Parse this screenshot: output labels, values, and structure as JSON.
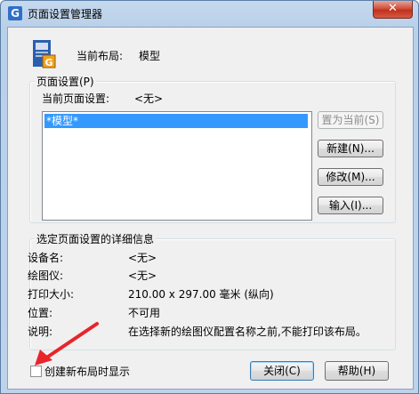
{
  "window": {
    "title": "页面设置管理器",
    "app_icon_letter": "G",
    "close_glyph": "✕"
  },
  "current_layout": {
    "label": "当前布局:",
    "value": "模型"
  },
  "page_setup": {
    "group_title": "页面设置(P)",
    "current_label": "当前页面设置:",
    "current_value": "<无>",
    "list_items": [
      "*模型*"
    ],
    "buttons": {
      "set_current": "置为当前(S)",
      "new": "新建(N)...",
      "modify": "修改(M)...",
      "import": "输入(I)..."
    }
  },
  "details": {
    "group_title": "选定页面设置的详细信息",
    "rows": [
      {
        "label": "设备名:",
        "value": "<无>"
      },
      {
        "label": "绘图仪:",
        "value": "<无>"
      },
      {
        "label": "打印大小:",
        "value": "210.00 x 297.00 毫米 (纵向)"
      },
      {
        "label": "位置:",
        "value": "不可用"
      },
      {
        "label": "说明:",
        "value": "在选择新的绘图仪配置名称之前,不能打印该布局。"
      }
    ]
  },
  "footer": {
    "checkbox_label": "创建新布局时显示",
    "checkbox_checked": false,
    "close_button": "关闭(C)",
    "help_button": "帮助(H)"
  },
  "colors": {
    "selection": "#3399ff",
    "arrow": "#e8252a"
  }
}
